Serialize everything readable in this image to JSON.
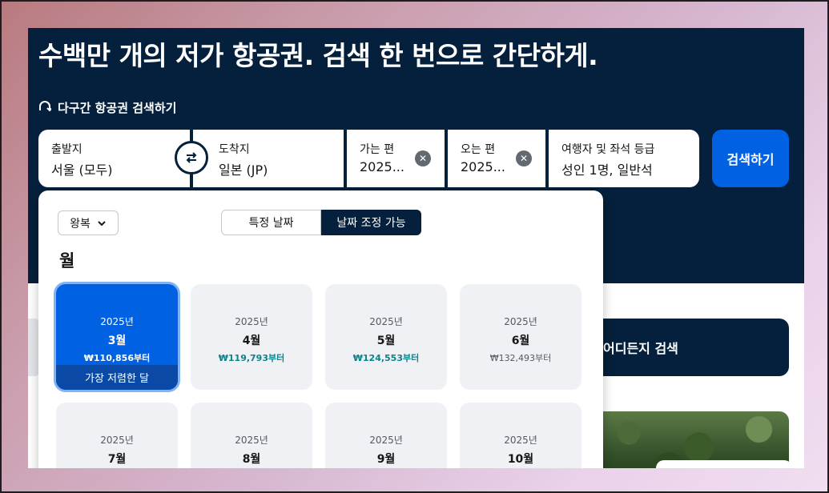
{
  "hero": {
    "title": "수백만 개의 저가 항공권. 검색 한 번으로 간단하게.",
    "multi_city_label": "다구간 항공권 검색하기"
  },
  "search_form": {
    "origin": {
      "label": "출발지",
      "value": "서울 (모두)"
    },
    "destination": {
      "label": "도착지",
      "value": "일본 (JP)"
    },
    "depart": {
      "label": "가는 편",
      "value": "2025..."
    },
    "return": {
      "label": "오는 편",
      "value": "2025..."
    },
    "travellers": {
      "label": "여행자 및 좌석 등급",
      "value": "성인 1명, 일반석"
    },
    "search_button": "검색하기"
  },
  "date_picker": {
    "trip_type": "왕복",
    "tabs": {
      "specific": "특정 날짜",
      "flexible": "날짜 조정 가능"
    },
    "section_title": "월",
    "cheapest_badge": "가장 저렴한 달",
    "months": [
      {
        "year": "2025년",
        "month": "3월",
        "price": "₩110,856부터",
        "selected": true,
        "cheapest": true
      },
      {
        "year": "2025년",
        "month": "4월",
        "price": "₩119,793부터",
        "highlight": true
      },
      {
        "year": "2025년",
        "month": "5월",
        "price": "₩124,553부터",
        "highlight": true
      },
      {
        "year": "2025년",
        "month": "6월",
        "price": "₩132,493부터"
      },
      {
        "year": "2025년",
        "month": "7월",
        "price": ""
      },
      {
        "year": "2025년",
        "month": "8월",
        "price": ""
      },
      {
        "year": "2025년",
        "month": "9월",
        "price": ""
      },
      {
        "year": "2025년",
        "month": "10월",
        "price": ""
      }
    ]
  },
  "explore": {
    "anywhere_label": "어디든지 검색"
  },
  "colors": {
    "navy": "#05203c",
    "primary": "#0062e3",
    "price_green": "#0c838a"
  }
}
